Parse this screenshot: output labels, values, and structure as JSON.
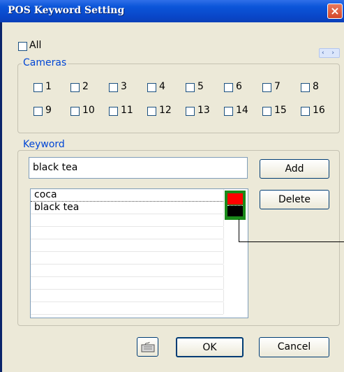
{
  "window": {
    "title": "POS Keyword Setting",
    "close_glyph": "×"
  },
  "all_checkbox": {
    "label": "All",
    "checked": false
  },
  "cameras": {
    "group_label": "Cameras",
    "scroll_glyph": "‹ ›",
    "items": [
      {
        "label": "1"
      },
      {
        "label": "2"
      },
      {
        "label": "3"
      },
      {
        "label": "4"
      },
      {
        "label": "5"
      },
      {
        "label": "6"
      },
      {
        "label": "7"
      },
      {
        "label": "8"
      },
      {
        "label": "9"
      },
      {
        "label": "10"
      },
      {
        "label": "11"
      },
      {
        "label": "12"
      },
      {
        "label": "13"
      },
      {
        "label": "14"
      },
      {
        "label": "15"
      },
      {
        "label": "16"
      }
    ]
  },
  "keyword": {
    "group_label": "Keyword",
    "input_value": "black tea",
    "add_label": "Add",
    "delete_label": "Delete",
    "list": [
      {
        "text": "coca",
        "color": "#ff0000"
      },
      {
        "text": "black tea",
        "color": "#000000"
      }
    ]
  },
  "footer": {
    "keyboard_icon": "keyboard-icon",
    "ok_label": "OK",
    "cancel_label": "Cancel"
  }
}
